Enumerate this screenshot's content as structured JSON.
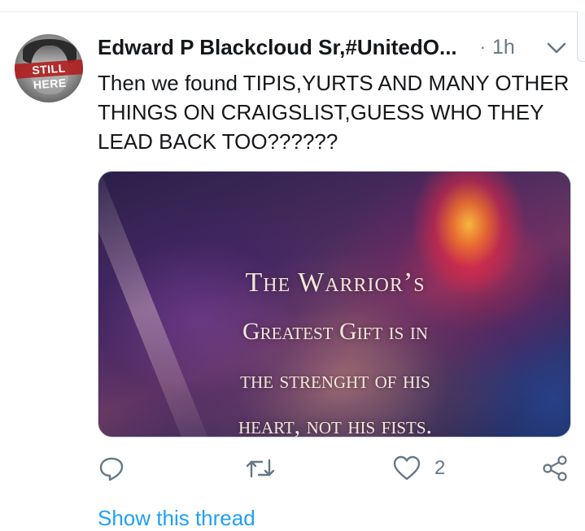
{
  "tweet": {
    "author_display": "Edward P Blackcloud Sr,#UnitedO...",
    "separator": "·",
    "time": "1h",
    "avatar_text": "STILL HERE",
    "text": "Then we found TIPIS,YURTS AND MANY OTHER THINGS ON CRAIGSLIST,GUESS WHO THEY LEAD BACK TOO??????",
    "media": {
      "lines": [
        "The Warrior’s",
        "Greatest Gift is in",
        "the strenght of his",
        "heart, not his fists."
      ]
    },
    "actions": {
      "like_count": "2"
    },
    "show_thread": "Show this thread"
  },
  "colors": {
    "link": "#1da1f2",
    "muted": "#657786",
    "text": "#14171a",
    "divider": "#e6ecf0"
  },
  "icons": [
    "chevron-down-icon",
    "reply-icon",
    "retweet-icon",
    "heart-icon",
    "share-icon"
  ]
}
